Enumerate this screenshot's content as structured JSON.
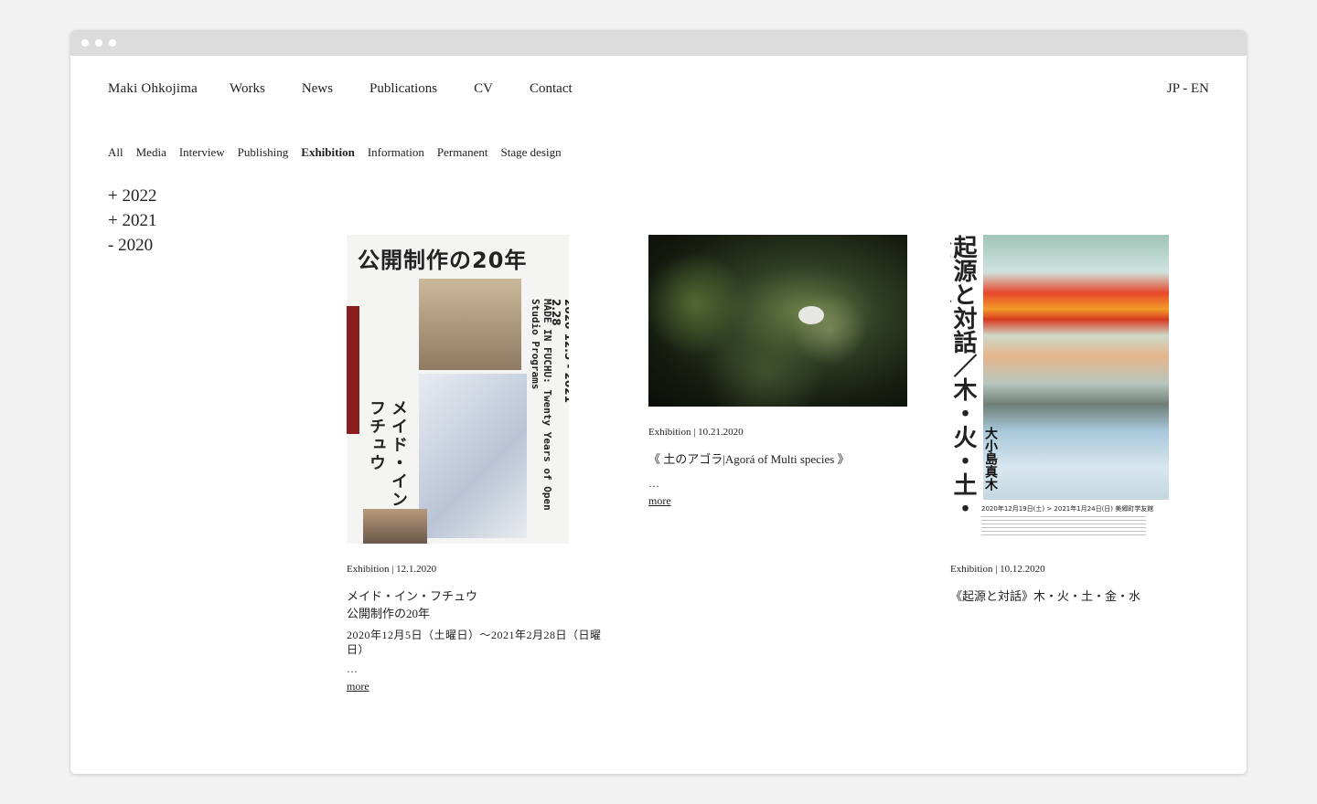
{
  "brand": "Maki Ohkojima",
  "nav": [
    "Works",
    "News",
    "Publications",
    "CV",
    "Contact"
  ],
  "lang": "JP - EN",
  "filters": [
    "All",
    "Media",
    "Interview",
    "Publishing",
    "Exhibition",
    "Information",
    "Permanent",
    "Stage design"
  ],
  "active_filter": "Exhibition",
  "years": [
    "+ 2022",
    "+ 2021",
    "- 2020"
  ],
  "cards": [
    {
      "meta": "Exhibition | 12.1.2020",
      "title1": "メイド・イン・フチュウ",
      "title2": "公開制作の20年",
      "sub": "2020年12月5日（土曜日）～2021年2月28日（日曜日）",
      "ellipsis": "…",
      "more": "more",
      "poster_title": "公開制作の20年",
      "poster_vertical": "メイド・イン・フチュウ",
      "poster_en": "MADE IN FUCHU: Twenty Years of Open Studio Programs",
      "poster_dates": "2020 12.5 - 2021 2.28"
    },
    {
      "meta": "Exhibition | 10.21.2020",
      "title1": "《 土のアゴラ|Agorá of Multi species 》",
      "ellipsis": "…",
      "more": "more"
    },
    {
      "meta": "Exhibition | 10.12.2020",
      "title1": "《起源と対話》木・火・土・金・水",
      "poster_vertical": "起源と対話／木・火・土・金・水",
      "poster_artist": "大小島真木",
      "poster_dates": "2020年12月19日(土) > 2021年1月24日(日) 美郷町学友館"
    }
  ],
  "colors": {
    "background": "#f2f2f2",
    "window": "#ffffff",
    "titlebar": "#dcdcdc",
    "text": "#222222"
  }
}
